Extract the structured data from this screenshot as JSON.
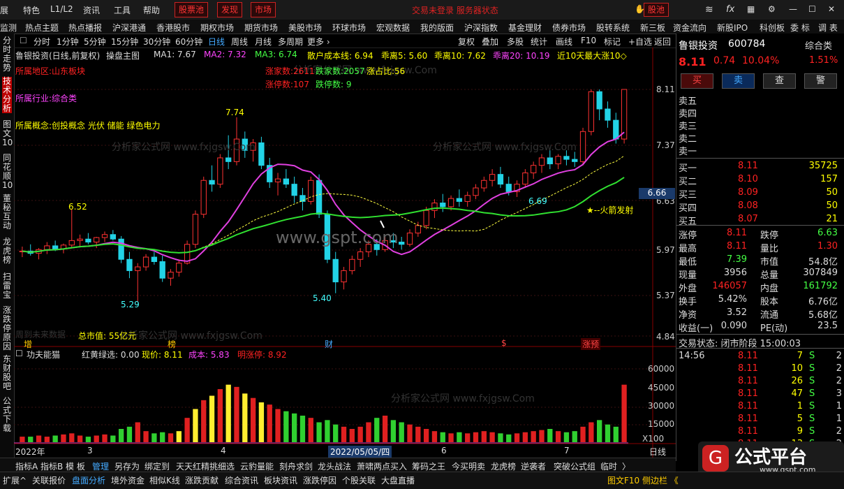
{
  "topbar": {
    "menu": [
      "展",
      "特色",
      "L1/L2",
      "资讯",
      "工具",
      "帮助"
    ],
    "stock_pool": "股票池",
    "discover": "发现",
    "market": "市场",
    "center_text": "交易未登录  服务器状态",
    "gupool_btn": "股池"
  },
  "nav": [
    "监测",
    "热点主题",
    "热点播报",
    "沪深港通",
    "香港股市",
    "期权市场",
    "期货市场",
    "美股市场",
    "环球市场",
    "宏观数据",
    "我的版面",
    "沪深指数",
    "基金理财",
    "债券市场",
    "股转系统",
    "新三板",
    "资金流向",
    "新股IPO",
    "科创板",
    "委 标",
    "调 表"
  ],
  "leftbar": [
    "分时走势",
    "技术分析",
    "图文10",
    "同花顺10",
    "董秘互动",
    "龙虎榜",
    "扫雷宝",
    "涨跌停原因",
    "东财股吧",
    "公式下载"
  ],
  "periods": [
    "分时",
    "1分钟",
    "5分钟",
    "15分钟",
    "30分钟",
    "60分钟",
    "日线",
    "周线",
    "月线",
    "多周期",
    "更多 ›"
  ],
  "tools": [
    "复权",
    "叠加",
    "多股",
    "统计",
    "画线",
    "F10",
    "标记",
    "+自选",
    "返回"
  ],
  "chart_header": {
    "name": "鲁银投资(日线,前复权)",
    "indicator": "操盘主图",
    "ma1": "MA1: 7.67",
    "ma2": "MA2: 7.32",
    "ma3": "MA3: 6.74",
    "cost": "散户成本线: 6.94",
    "gl5": "乖离5: 5.60",
    "gl10": "乖离10: 7.62",
    "gl20": "乖离20: 10.19",
    "near10": "近10天最大涨10◇"
  },
  "info": {
    "region": "所属地区:山东板块",
    "industry": "所属行业:综合类",
    "concept": "所属概念:创投概念 光伏 储能 绿色电力",
    "up_count": "涨家数:2611",
    "down_count": "跌家数:2057",
    "ratio": "涨占比:56",
    "limit_up": "涨停数:107",
    "limit_down": "跌停数: 9",
    "total_mv": "总市值: 55亿元",
    "no_data": "周到未来数据"
  },
  "annotations": {
    "high": "7.74",
    "low1": "5.29",
    "low2": "5.40",
    "p652": "6.52",
    "p669": "6.69",
    "rocket": "★--火箭发射"
  },
  "markers": [
    "增",
    "榜",
    "财",
    "$",
    "涨预"
  ],
  "price_axis": [
    "8.11",
    "7.37",
    "6.63",
    "5.97",
    "5.37",
    "4.84"
  ],
  "current_tag": "6.66",
  "vol_header": {
    "name": "功夫能猫",
    "a": "红黄绿选: 0.00",
    "b": "现价: 8.11",
    "c": "成本: 5.83",
    "d": "明涨停: 8.92"
  },
  "vol_axis": [
    "60000",
    "45000",
    "30000",
    "15000",
    "X100"
  ],
  "date_axis": {
    "year": "2022年",
    "m3": "3",
    "m4": "4",
    "cursor": "2022/05/05/四",
    "m6": "6",
    "m7": "7"
  },
  "day_label": "日线",
  "bottom1": [
    "指标A",
    "指标B",
    "模 板",
    "管理",
    "另存为",
    "绑定到",
    "天天红精挑细选",
    "云豹量能",
    "刻舟求剑",
    "龙头战法",
    "萧啸两点买入",
    "筹码之王",
    "今买明卖",
    "龙虎榜",
    "逆袭者",
    "突破公式组",
    "临时",
    "〉"
  ],
  "bottom2": [
    "扩展^",
    "关联报价",
    "盘面分析",
    "境外资金",
    "相似K线",
    "涨跌贡献",
    "综合资讯",
    "板块资讯",
    "涨跌停因",
    "个股关联",
    "大盘直播"
  ],
  "bottom2_right": "图文F10  侧边栏 《",
  "watermark": "分析家公式网 www.fxjgsw.Com",
  "gspt": "www.gspt.com",
  "logo_text": "公式平台",
  "logo_url": "www.gspt.com",
  "quote": {
    "name": "鲁银投资",
    "code": "600784",
    "category": "综合类",
    "price": "8.11",
    "change": "0.74",
    "pct": "10.04%",
    "side_pct": "1.51%",
    "buttons": [
      "买",
      "卖",
      "查",
      "警"
    ],
    "sells": [
      "卖五",
      "卖四",
      "卖三",
      "卖二",
      "卖一"
    ],
    "buys": [
      [
        "买一",
        "8.11",
        "35725"
      ],
      [
        "买二",
        "8.10",
        "157"
      ],
      [
        "买三",
        "8.09",
        "50"
      ],
      [
        "买四",
        "8.08",
        "50"
      ],
      [
        "买五",
        "8.07",
        "21"
      ]
    ],
    "stats": [
      [
        "涨停",
        "8.11",
        "跌停",
        "6.63"
      ],
      [
        "最高",
        "8.11",
        "量比",
        "1.30"
      ],
      [
        "最低",
        "7.39",
        "市值",
        "54.8亿"
      ],
      [
        "现量",
        "3956",
        "总量",
        "307849"
      ],
      [
        "外盘",
        "146057",
        "内盘",
        "161792"
      ],
      [
        "换手",
        "5.42%",
        "股本",
        "6.76亿"
      ],
      [
        "净资",
        "3.52",
        "流通",
        "5.68亿"
      ],
      [
        "收益(一)",
        "0.090",
        "PE(动)",
        "23.5"
      ]
    ],
    "trade_status": "交易状态: 闭市阶段 15:00:03",
    "ticks": [
      [
        "14:56",
        "8.11",
        "7",
        "S",
        "2"
      ],
      [
        "",
        "8.11",
        "10",
        "S",
        "2"
      ],
      [
        "",
        "8.11",
        "26",
        "S",
        "2"
      ],
      [
        "",
        "8.11",
        "47",
        "S",
        "3"
      ],
      [
        "",
        "8.11",
        "1",
        "S",
        "1"
      ],
      [
        "",
        "8.11",
        "5",
        "S",
        "1"
      ],
      [
        "",
        "8.11",
        "9",
        "S",
        "2"
      ],
      [
        "",
        "8.11",
        "13",
        "S",
        "2"
      ]
    ]
  },
  "chart_data": {
    "type": "candlestick",
    "ylim": [
      4.84,
      8.45
    ],
    "ohlc": [
      [
        5.95,
        6.02,
        5.88,
        5.96
      ],
      [
        5.96,
        6.05,
        5.9,
        5.93
      ],
      [
        5.93,
        6.0,
        5.85,
        5.98
      ],
      [
        5.98,
        6.08,
        5.92,
        6.03
      ],
      [
        6.03,
        6.1,
        5.96,
        5.99
      ],
      [
        5.99,
        6.06,
        5.93,
        6.04
      ],
      [
        6.04,
        6.52,
        6.0,
        6.1
      ],
      [
        6.1,
        6.18,
        6.02,
        6.12
      ],
      [
        6.12,
        6.2,
        6.05,
        6.08
      ],
      [
        6.08,
        6.15,
        6.0,
        6.14
      ],
      [
        6.14,
        6.22,
        6.08,
        6.18
      ],
      [
        6.18,
        6.24,
        6.1,
        6.12
      ],
      [
        6.12,
        6.16,
        5.8,
        5.85
      ],
      [
        5.85,
        5.95,
        5.6,
        5.7
      ],
      [
        5.7,
        5.8,
        5.29,
        5.75
      ],
      [
        5.75,
        5.92,
        5.7,
        5.88
      ],
      [
        5.88,
        5.95,
        5.78,
        5.82
      ],
      [
        5.82,
        5.9,
        5.55,
        5.6
      ],
      [
        5.6,
        5.72,
        5.5,
        5.68
      ],
      [
        5.68,
        5.85,
        5.62,
        5.8
      ],
      [
        5.8,
        6.1,
        5.78,
        6.05
      ],
      [
        6.05,
        6.5,
        6.0,
        6.45
      ],
      [
        6.45,
        6.95,
        6.4,
        6.9
      ],
      [
        6.9,
        7.1,
        6.75,
        6.85
      ],
      [
        6.85,
        7.25,
        6.8,
        7.2
      ],
      [
        7.2,
        7.5,
        7.05,
        7.15
      ],
      [
        7.15,
        7.74,
        7.1,
        7.45
      ],
      [
        7.45,
        7.55,
        7.2,
        7.3
      ],
      [
        7.3,
        7.45,
        7.15,
        7.4
      ],
      [
        7.4,
        7.48,
        7.05,
        7.1
      ],
      [
        7.1,
        7.2,
        6.8,
        6.88
      ],
      [
        6.88,
        7.0,
        6.7,
        6.92
      ],
      [
        6.92,
        7.05,
        6.8,
        6.85
      ],
      [
        6.85,
        6.95,
        6.6,
        6.7
      ],
      [
        6.7,
        6.8,
        6.5,
        6.62
      ],
      [
        6.62,
        6.95,
        6.58,
        6.9
      ],
      [
        6.9,
        6.98,
        6.4,
        6.45
      ],
      [
        6.45,
        6.5,
        5.8,
        5.85
      ],
      [
        5.85,
        5.95,
        5.4,
        5.55
      ],
      [
        5.55,
        5.75,
        5.45,
        5.7
      ],
      [
        5.7,
        5.9,
        5.65,
        5.85
      ],
      [
        5.85,
        6.0,
        5.75,
        5.95
      ],
      [
        5.95,
        6.1,
        5.88,
        6.05
      ],
      [
        6.05,
        6.12,
        5.9,
        5.98
      ],
      [
        5.98,
        6.15,
        5.95,
        6.1
      ],
      [
        6.1,
        6.2,
        6.0,
        6.08
      ],
      [
        6.08,
        6.15,
        5.98,
        6.05
      ],
      [
        6.05,
        6.25,
        6.02,
        6.2
      ],
      [
        6.2,
        6.35,
        6.15,
        6.3
      ],
      [
        6.3,
        6.55,
        6.25,
        6.5
      ],
      [
        6.5,
        6.65,
        6.4,
        6.6
      ],
      [
        6.6,
        6.72,
        6.48,
        6.55
      ],
      [
        6.55,
        6.7,
        6.5,
        6.66
      ],
      [
        6.66,
        6.78,
        6.55,
        6.62
      ],
      [
        6.62,
        6.75,
        6.55,
        6.7
      ],
      [
        6.7,
        6.85,
        6.65,
        6.8
      ],
      [
        6.8,
        6.95,
        6.75,
        6.9
      ],
      [
        6.9,
        7.05,
        6.82,
        6.98
      ],
      [
        6.98,
        7.08,
        6.8,
        6.85
      ],
      [
        6.85,
        6.95,
        6.7,
        6.75
      ],
      [
        6.75,
        6.9,
        6.68,
        6.85
      ],
      [
        6.85,
        7.05,
        6.8,
        7.0
      ],
      [
        7.0,
        7.15,
        6.92,
        7.1
      ],
      [
        7.1,
        7.25,
        7.0,
        7.2
      ],
      [
        7.2,
        7.3,
        7.05,
        7.12
      ],
      [
        7.12,
        7.25,
        7.05,
        7.22
      ],
      [
        7.22,
        7.3,
        7.1,
        7.18
      ],
      [
        7.18,
        7.28,
        7.08,
        7.15
      ],
      [
        7.15,
        7.6,
        7.1,
        7.55
      ],
      [
        7.55,
        8.11,
        7.5,
        8.08
      ],
      [
        8.08,
        8.11,
        7.7,
        7.85
      ],
      [
        7.85,
        7.95,
        7.6,
        7.7
      ],
      [
        7.7,
        7.8,
        7.39,
        7.45
      ],
      [
        7.45,
        8.11,
        7.39,
        8.11
      ]
    ],
    "volume": [
      5,
      5,
      6,
      5,
      6,
      7,
      8,
      6,
      5,
      6,
      7,
      6,
      12,
      14,
      18,
      10,
      8,
      9,
      8,
      10,
      22,
      30,
      38,
      42,
      48,
      52,
      50,
      44,
      40,
      36,
      34,
      30,
      28,
      26,
      24,
      22,
      18,
      20,
      16,
      14,
      12,
      14,
      18,
      22,
      24,
      20,
      18,
      16,
      14,
      12,
      10,
      9,
      8,
      9,
      8,
      9,
      10,
      9,
      8,
      7,
      8,
      9,
      10,
      11,
      12,
      10,
      9,
      10,
      14,
      18,
      20,
      16,
      14,
      52
    ],
    "vol_colors": "r"
  }
}
